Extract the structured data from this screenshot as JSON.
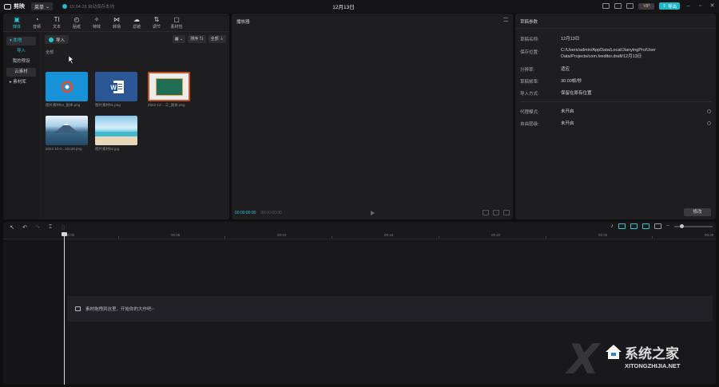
{
  "app": {
    "logo_text": "剪映",
    "menu_label": "菜单",
    "autosave_text": "15:04:28 自动保存本地",
    "title": "12月13日",
    "vip_label": "VIP",
    "export_label": "导出"
  },
  "tool_tabs": [
    {
      "label": "媒体",
      "icon": "▣"
    },
    {
      "label": "音频",
      "icon": "◔"
    },
    {
      "label": "文本",
      "icon": "TI"
    },
    {
      "label": "贴纸",
      "icon": "◴"
    },
    {
      "label": "特效",
      "icon": "✧"
    },
    {
      "label": "转场",
      "icon": "⋈"
    },
    {
      "label": "滤镜",
      "icon": "☁"
    },
    {
      "label": "调节",
      "icon": "⇅"
    },
    {
      "label": "素材包",
      "icon": "▢"
    }
  ],
  "media_side": {
    "local": "▾ 本地",
    "import": "导入",
    "presets": "我的预设",
    "cloud": "云素材",
    "library": "▸ 素材库"
  },
  "media_toolbar": {
    "import_label": "导入",
    "view_label": "▦ ⌄",
    "sort_label": "排序 ⇅",
    "filter_label": "全部 ⏚",
    "section_label": "全部"
  },
  "media_items": [
    {
      "label": "图片素材03_副本.png"
    },
    {
      "label": "图片素材01.png"
    },
    {
      "label": "2022-12-...三_副本.png"
    },
    {
      "label": "2022-10-0...33128.png"
    },
    {
      "label": "图片素材02.jpg"
    }
  ],
  "player": {
    "title": "播放器",
    "current_time": "00:00:00:00",
    "total_time": "00:00:00:00"
  },
  "props": {
    "title": "草稿参数",
    "rows": [
      {
        "label": "草稿名称:",
        "value": "12月13日"
      },
      {
        "label": "保存位置:",
        "value": "C:/Users/admin/AppData/Local/JianyingPro/User Data/Projects/com.lveditor.draft/12月13日"
      },
      {
        "label": "分辨率:",
        "value": "适应"
      },
      {
        "label": "草稿帧率:",
        "value": "30.00帧/秒"
      },
      {
        "label": "导入方式:",
        "value": "保留在原有位置"
      },
      {
        "label": "代理模式:",
        "value": "未开启"
      },
      {
        "label": "自由层级:",
        "value": "未开启"
      }
    ],
    "modify_label": "修改"
  },
  "timeline": {
    "ticks": [
      "00:00",
      "00:05",
      "00:10",
      "00:15",
      "00:20",
      "00:25",
      "00:30"
    ],
    "drop_hint": "素材拖拽到这里，开始你的大作吧~"
  },
  "watermark": {
    "zh": "系统之家",
    "en": "XITONGZHIJIA.NET"
  },
  "colors": {
    "accent": "#2bc4d4",
    "export": "#1fb6c6",
    "panel": "#1e1e21",
    "background": "#0f0f10"
  }
}
